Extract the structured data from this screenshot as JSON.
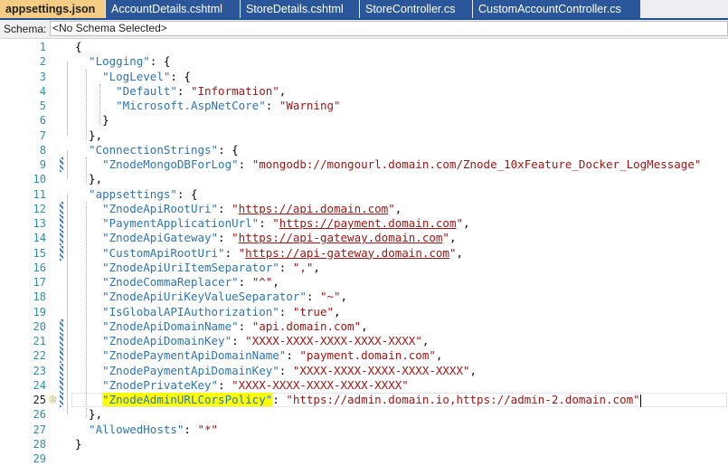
{
  "tabs": [
    {
      "label": "appsettings.json",
      "active": true
    },
    {
      "label": "AccountDetails.cshtml",
      "active": false
    },
    {
      "label": "StoreDetails.cshtml",
      "active": false
    },
    {
      "label": "StoreController.cs",
      "active": false
    },
    {
      "label": "CustomAccountController.cs",
      "active": false
    }
  ],
  "schema": {
    "label": "Schema:",
    "value": "<No Schema Selected>"
  },
  "editor": {
    "current_line": 25,
    "lines": [
      {
        "n": "1",
        "t": [
          [
            "p",
            "{"
          ]
        ]
      },
      {
        "n": "2",
        "t": [
          [
            "p",
            "  "
          ],
          [
            "k",
            "\"Logging\""
          ],
          [
            "p",
            ": {"
          ]
        ]
      },
      {
        "n": "3",
        "t": [
          [
            "p",
            "    "
          ],
          [
            "k",
            "\"LogLevel\""
          ],
          [
            "p",
            ": {"
          ]
        ]
      },
      {
        "n": "4",
        "t": [
          [
            "p",
            "      "
          ],
          [
            "k",
            "\"Default\""
          ],
          [
            "p",
            ": "
          ],
          [
            "s",
            "\"Information\""
          ],
          [
            "p",
            ","
          ]
        ]
      },
      {
        "n": "5",
        "t": [
          [
            "p",
            "      "
          ],
          [
            "k",
            "\"Microsoft.AspNetCore\""
          ],
          [
            "p",
            ": "
          ],
          [
            "s",
            "\"Warning\""
          ]
        ]
      },
      {
        "n": "6",
        "t": [
          [
            "p",
            "    }"
          ]
        ]
      },
      {
        "n": "7",
        "t": [
          [
            "p",
            "  },"
          ]
        ]
      },
      {
        "n": "8",
        "t": [
          [
            "p",
            "  "
          ],
          [
            "k",
            "\"ConnectionStrings\""
          ],
          [
            "p",
            ": {"
          ]
        ]
      },
      {
        "n": "9",
        "t": [
          [
            "p",
            "    "
          ],
          [
            "k",
            "\"ZnodeMongoDBForLog\""
          ],
          [
            "p",
            ": "
          ],
          [
            "s",
            "\"mongodb://mongourl.domain.com/Znode_10xFeature_Docker_LogMessage\""
          ]
        ]
      },
      {
        "n": "10",
        "t": [
          [
            "p",
            "  },"
          ]
        ]
      },
      {
        "n": "11",
        "t": [
          [
            "p",
            "  "
          ],
          [
            "k",
            "\"appsettings\""
          ],
          [
            "p",
            ": {"
          ]
        ]
      },
      {
        "n": "12",
        "t": [
          [
            "p",
            "    "
          ],
          [
            "k",
            "\"ZnodeApiRootUri\""
          ],
          [
            "p",
            ": "
          ],
          [
            "s",
            "\""
          ],
          [
            "u",
            "https://api.domain.com"
          ],
          [
            "s",
            "\""
          ],
          [
            "p",
            ","
          ]
        ]
      },
      {
        "n": "13",
        "t": [
          [
            "p",
            "    "
          ],
          [
            "k",
            "\"PaymentApplicationUrl\""
          ],
          [
            "p",
            ": "
          ],
          [
            "s",
            "\""
          ],
          [
            "u",
            "https://payment.domain.com"
          ],
          [
            "s",
            "\""
          ],
          [
            "p",
            ","
          ]
        ]
      },
      {
        "n": "14",
        "t": [
          [
            "p",
            "    "
          ],
          [
            "k",
            "\"ZnodeApiGateway\""
          ],
          [
            "p",
            ": "
          ],
          [
            "s",
            "\""
          ],
          [
            "u",
            "https://api-gateway.domain.com"
          ],
          [
            "s",
            "\""
          ],
          [
            "p",
            ","
          ]
        ]
      },
      {
        "n": "15",
        "t": [
          [
            "p",
            "    "
          ],
          [
            "k",
            "\"CustomApiRootUri\""
          ],
          [
            "p",
            ": "
          ],
          [
            "s",
            "\""
          ],
          [
            "u",
            "https://api-gateway.domain.com"
          ],
          [
            "s",
            "\""
          ],
          [
            "p",
            ","
          ]
        ]
      },
      {
        "n": "16",
        "t": [
          [
            "p",
            "    "
          ],
          [
            "k",
            "\"ZnodeApiUriItemSeparator\""
          ],
          [
            "p",
            ": "
          ],
          [
            "s",
            "\",\""
          ],
          [
            "p",
            ","
          ]
        ]
      },
      {
        "n": "17",
        "t": [
          [
            "p",
            "    "
          ],
          [
            "k",
            "\"ZnodeCommaReplacer\""
          ],
          [
            "p",
            ": "
          ],
          [
            "s",
            "\"^\""
          ],
          [
            "p",
            ","
          ]
        ]
      },
      {
        "n": "18",
        "t": [
          [
            "p",
            "    "
          ],
          [
            "k",
            "\"ZnodeApiUriKeyValueSeparator\""
          ],
          [
            "p",
            ": "
          ],
          [
            "s",
            "\"~\""
          ],
          [
            "p",
            ","
          ]
        ]
      },
      {
        "n": "19",
        "t": [
          [
            "p",
            "    "
          ],
          [
            "k",
            "\"IsGlobalAPIAuthorization\""
          ],
          [
            "p",
            ": "
          ],
          [
            "s",
            "\"true\""
          ],
          [
            "p",
            ","
          ]
        ]
      },
      {
        "n": "20",
        "t": [
          [
            "p",
            "    "
          ],
          [
            "k",
            "\"ZnodeApiDomainName\""
          ],
          [
            "p",
            ": "
          ],
          [
            "s",
            "\"api.domain.com\""
          ],
          [
            "p",
            ","
          ]
        ]
      },
      {
        "n": "21",
        "t": [
          [
            "p",
            "    "
          ],
          [
            "k",
            "\"ZnodeApiDomainKey\""
          ],
          [
            "p",
            ": "
          ],
          [
            "s",
            "\"XXXX-XXXX-XXXX-XXXX-XXXX\""
          ],
          [
            "p",
            ","
          ]
        ]
      },
      {
        "n": "22",
        "t": [
          [
            "p",
            "    "
          ],
          [
            "k",
            "\"ZnodePaymentApiDomainName\""
          ],
          [
            "p",
            ": "
          ],
          [
            "s",
            "\"payment.domain.com\""
          ],
          [
            "p",
            ","
          ]
        ]
      },
      {
        "n": "23",
        "t": [
          [
            "p",
            "    "
          ],
          [
            "k",
            "\"ZnodePaymentApiDomainKey\""
          ],
          [
            "p",
            ": "
          ],
          [
            "s",
            "\"XXXX-XXXX-XXXX-XXXX-XXXX\""
          ],
          [
            "p",
            ","
          ]
        ]
      },
      {
        "n": "24",
        "t": [
          [
            "p",
            "    "
          ],
          [
            "k",
            "\"ZnodePrivateKey\""
          ],
          [
            "p",
            ": "
          ],
          [
            "s",
            "\"XXXX-XXXX-XXXX-XXXX-XXXX\""
          ]
        ]
      },
      {
        "n": "25",
        "t": [
          [
            "p",
            "    "
          ],
          [
            "kh",
            "\"ZnodeAdminURLCorsPolicy\""
          ],
          [
            "p",
            ": "
          ],
          [
            "s",
            "\"https://admin.domain.io,https://admin-2.domain.com\""
          ]
        ]
      },
      {
        "n": "26",
        "t": [
          [
            "p",
            "  },"
          ]
        ]
      },
      {
        "n": "27",
        "t": [
          [
            "p",
            "  "
          ],
          [
            "k",
            "\"AllowedHosts\""
          ],
          [
            "p",
            ": "
          ],
          [
            "s",
            "\"*\""
          ]
        ]
      },
      {
        "n": "28",
        "t": [
          [
            "p",
            "}"
          ]
        ]
      },
      {
        "n": "29",
        "t": []
      }
    ]
  },
  "colors": {
    "key": "#2e75b6",
    "string": "#a31515",
    "tab_active": "#f5cc84",
    "tab_inactive": "#2b579a",
    "highlight": "#ffff00"
  },
  "icons": {
    "lightbulb": "lightbulb-icon"
  }
}
